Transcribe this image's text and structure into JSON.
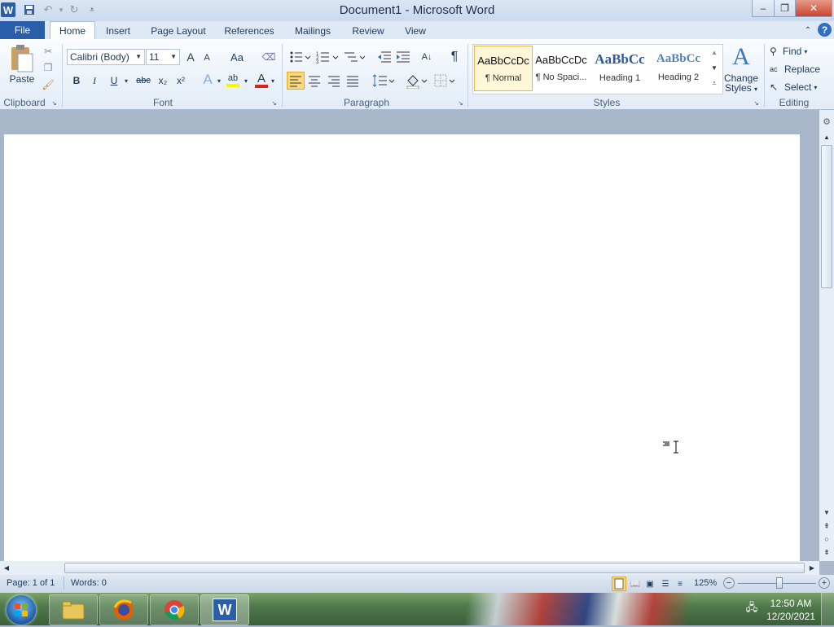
{
  "window": {
    "title": "Document1  -  Microsoft Word",
    "app_icon_letter": "W",
    "minimize": "–",
    "restore": "❐",
    "close": "✕"
  },
  "tabs": [
    "File",
    "Home",
    "Insert",
    "Page Layout",
    "References",
    "Mailings",
    "Review",
    "View"
  ],
  "ribbon": {
    "clipboard": {
      "paste": "Paste",
      "label": "Clipboard"
    },
    "font": {
      "name": "Calibri (Body)",
      "size": "11",
      "label": "Font",
      "bold": "B",
      "italic": "I",
      "underline": "U",
      "strike": "abc",
      "subscript": "x₂",
      "superscript": "x²",
      "grow": "A",
      "shrink": "A",
      "case": "Aa",
      "font_color": "A",
      "highlight": "ab",
      "effects": "A"
    },
    "paragraph": {
      "label": "Paragraph",
      "pilcrow": "¶"
    },
    "styles": {
      "label": "Styles",
      "items": [
        {
          "preview": "AaBbCcDc",
          "name": "¶ Normal"
        },
        {
          "preview": "AaBbCcDc",
          "name": "¶ No Spaci..."
        },
        {
          "preview": "AaBbCc",
          "name": "Heading 1"
        },
        {
          "preview": "AaBbCc",
          "name": "Heading 2"
        }
      ],
      "change_styles": [
        "Change",
        "Styles"
      ]
    },
    "editing": {
      "label": "Editing",
      "find": "Find",
      "replace": "Replace",
      "select": "Select"
    }
  },
  "status": {
    "page": "Page: 1 of 1",
    "words": "Words: 0",
    "zoom": "125%"
  },
  "taskbar": {
    "time": "12:50 AM",
    "date": "12/20/2021"
  },
  "colors": {
    "file_tab": "#2a5ea8",
    "font_color_bar": "#e0201b",
    "highlight_bar": "#f7f700"
  }
}
